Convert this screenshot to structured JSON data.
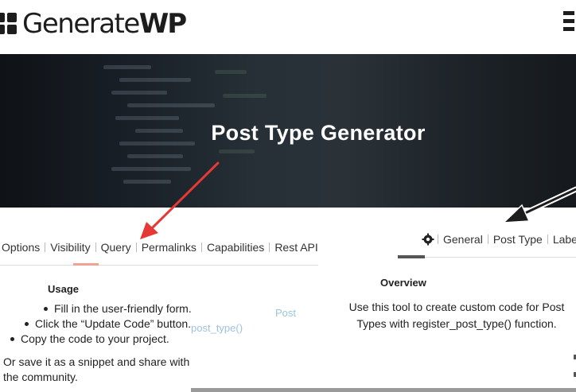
{
  "header": {
    "logo_text_light": "Generate",
    "logo_text_bold": "WP"
  },
  "hero": {
    "title": "Post Type Generator"
  },
  "left_panel": {
    "tabs": [
      {
        "label": "Options"
      },
      {
        "label": "Visibility"
      },
      {
        "label": "Query"
      },
      {
        "label": "Permalinks"
      },
      {
        "label": "Capabilities"
      },
      {
        "label": "Rest API"
      }
    ],
    "usage_title": "Usage",
    "usage_items": [
      "Fill in the user-friendly form.",
      "Click the “Update Code” button.",
      "Copy the code to your project."
    ],
    "usage_note": "Or save it as a snippet and share with the community.",
    "ghost_links": [
      "Post",
      "post_type()"
    ]
  },
  "right_panel": {
    "tabs": [
      {
        "label": "General"
      },
      {
        "label": "Post Type"
      },
      {
        "label": "Labels"
      }
    ],
    "overview_title": "Overview",
    "overview_text": "Use this tool to create custom code for Post Types with register_post_type() function."
  },
  "colors": {
    "arrow": "#e53935",
    "active_tab_left": "#f0a393",
    "active_tab_right": "#555555",
    "ghost_link": "#9cc3e0"
  }
}
